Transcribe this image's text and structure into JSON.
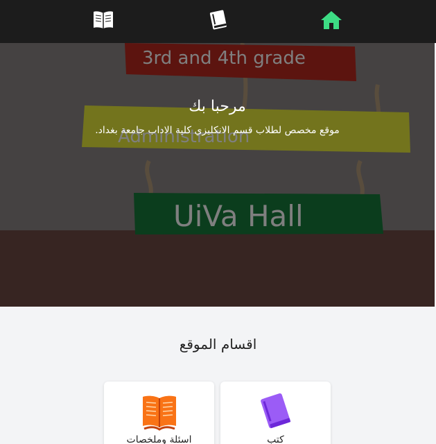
{
  "nav": {
    "items": [
      {
        "name": "open-book-icon",
        "color": "#ffffff"
      },
      {
        "name": "book-icon",
        "color": "#ffffff"
      },
      {
        "name": "home-icon",
        "color": "#3ddc84"
      }
    ]
  },
  "hero": {
    "title": "مرحبا بك",
    "subtitle": "موقع مخصص لطلاب قسم الانكليزي كلية الاداب جامعة بغداد.",
    "photo_signs": [
      "3rd and 4th grade",
      "Administration",
      "UiVa Hall"
    ]
  },
  "sections": {
    "title": "اقسام الموقع",
    "cards": [
      {
        "label": "كتب",
        "icon": "purple-book-icon",
        "color": "#9b5cf6"
      },
      {
        "label": "اسئلة وملخصات",
        "icon": "orange-open-book-icon",
        "color": "#f97316"
      }
    ]
  }
}
